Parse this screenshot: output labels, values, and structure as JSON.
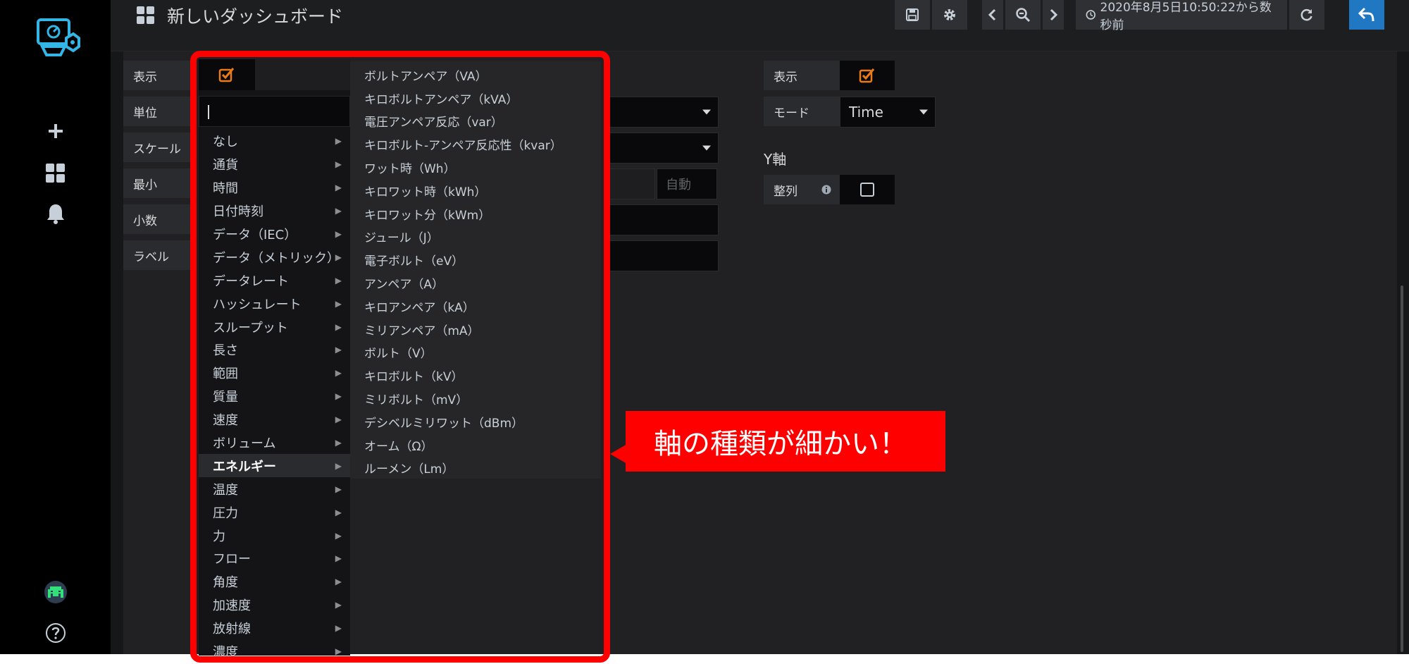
{
  "header": {
    "title": "新しいダッシュボード",
    "time_range": "2020年8月5日10:50:22から数秒前"
  },
  "left_axis": {
    "show_label": "表示",
    "unit_label": "単位",
    "scale_label": "スケール",
    "min_label": "最小",
    "decimals_label": "小数",
    "label_label": "ラベル",
    "max_placeholder": "自動"
  },
  "x_axis": {
    "show_label": "表示",
    "mode_label": "モード",
    "mode_value": "Time"
  },
  "y_axis": {
    "title": "Y軸",
    "align_label": "整列"
  },
  "unit_menu": {
    "categories": [
      {
        "label": "なし"
      },
      {
        "label": "通貨"
      },
      {
        "label": "時間"
      },
      {
        "label": "日付時刻"
      },
      {
        "label": "データ（IEC）"
      },
      {
        "label": "データ（メトリック）"
      },
      {
        "label": "データレート"
      },
      {
        "label": "ハッシュレート"
      },
      {
        "label": "スループット"
      },
      {
        "label": "長さ"
      },
      {
        "label": "範囲"
      },
      {
        "label": "質量"
      },
      {
        "label": "速度"
      },
      {
        "label": "ボリューム"
      },
      {
        "label": "エネルギー",
        "active": true
      },
      {
        "label": "温度"
      },
      {
        "label": "圧力"
      },
      {
        "label": "力"
      },
      {
        "label": "フロー"
      },
      {
        "label": "角度"
      },
      {
        "label": "加速度"
      },
      {
        "label": "放射線"
      },
      {
        "label": "濃度"
      }
    ],
    "energy_units": [
      "ボルトアンペア（VA）",
      "キロボルトアンペア（kVA）",
      "電圧アンペア反応（var）",
      "キロボルト-アンペア反応性（kvar）",
      "ワット時（Wh）",
      "キロワット時（kWh）",
      "キロワット分（kWm）",
      "ジュール（J）",
      "電子ボルト（eV）",
      "アンペア（A）",
      "キロアンペア（kA）",
      "ミリアンペア（mA）",
      "ボルト（V）",
      "キロボルト（kV）",
      "ミリボルト（mV）",
      "デシベルミリワット（dBm）",
      "オーム（Ω）",
      "ルーメン（Lm）"
    ]
  },
  "annotation": {
    "text": "軸の種類が細かい！"
  },
  "colors": {
    "sidebar_bg": "#000000",
    "panel_bg": "#212124",
    "check_orange": "#eb7b18",
    "accent_blue": "#1f78c1",
    "logo_cyan": "#33b5e5",
    "annotation_red": "#ff0000"
  }
}
